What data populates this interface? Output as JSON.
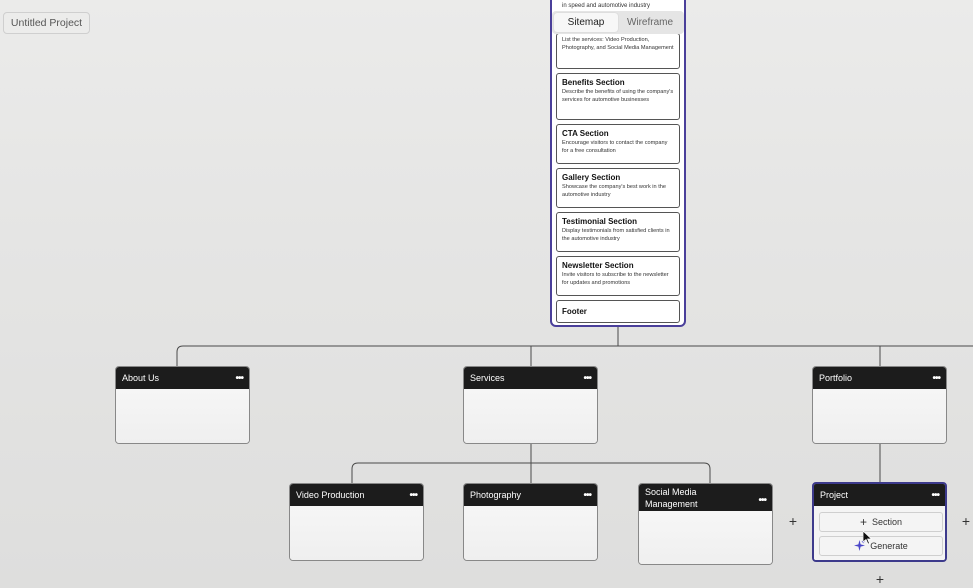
{
  "project": {
    "name": "Untitled Project"
  },
  "view_toggle": {
    "sitemap": "Sitemap",
    "wireframe": "Wireframe"
  },
  "home_card": {
    "top_text": "in speed and automotive industry",
    "sections": [
      {
        "title": "",
        "desc": "List the services: Video Production, Photography, and Social Media Management"
      },
      {
        "title": "Benefits Section",
        "desc": "Describe the benefits of using the company's services for automotive businesses"
      },
      {
        "title": "CTA Section",
        "desc": "Encourage visitors to contact the company for a free consultation"
      },
      {
        "title": "Gallery Section",
        "desc": "Showcase the company's best work in the automotive industry"
      },
      {
        "title": "Testimonial Section",
        "desc": "Display testimonials from satisfied clients in the automotive industry"
      },
      {
        "title": "Newsletter Section",
        "desc": "Invite visitors to subscribe to the newsletter for updates and promotions"
      },
      {
        "title": "Footer",
        "desc": ""
      }
    ]
  },
  "pages": {
    "about": "About Us",
    "services": "Services",
    "portfolio": "Portfolio",
    "video": "Video Production",
    "photography": "Photography",
    "social": "Social Media Management",
    "project": "Project"
  },
  "menu_dots": "•••",
  "project_node": {
    "add_section": "Section",
    "generate": "Generate"
  },
  "icons": {
    "plus": "plus-icon",
    "sparkle": "sparkle-icon",
    "dots": "more-options-icon"
  },
  "colors": {
    "accent": "#3d3a8c",
    "node_header": "#1c1c1c",
    "sparkle": "#4b47c9"
  }
}
